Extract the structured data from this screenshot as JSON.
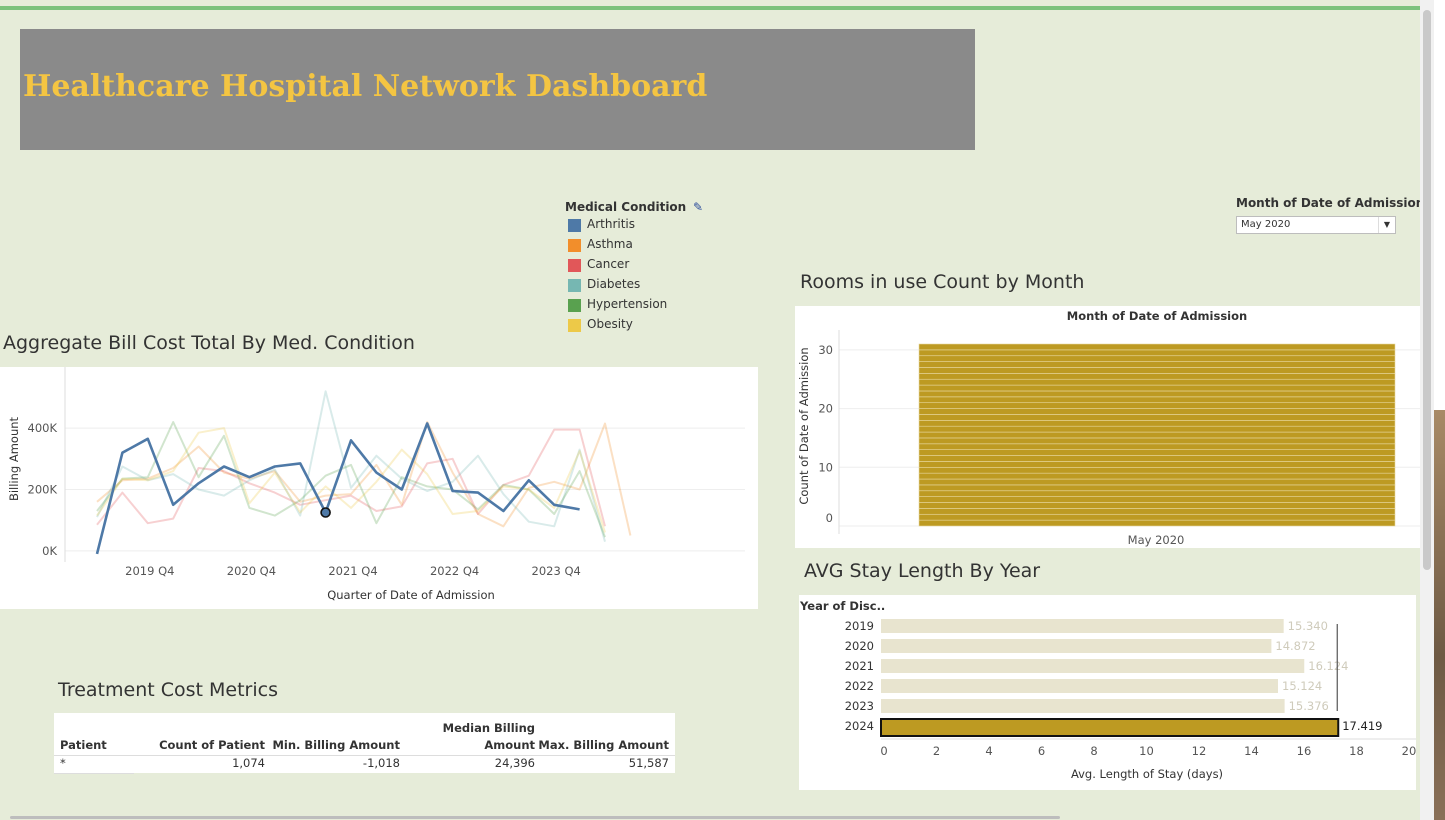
{
  "dashboard_title": "Healthcare Hospital Network Dashboard",
  "colors": {
    "accent_title": "#f4c542",
    "background": "#e6ecd9",
    "highlight_bar": "#bd9a22"
  },
  "sections": {
    "bill_cost": "Aggregate Bill Cost Total By Med. Condition",
    "rooms": "Rooms in use Count by Month",
    "stay": "AVG Stay Length By Year",
    "treatment": "Treatment Cost Metrics"
  },
  "legend": {
    "title": "Medical Condition",
    "edit_icon": "pencil-icon",
    "items": [
      {
        "label": "Arthritis",
        "color": "#4e79a7"
      },
      {
        "label": "Asthma",
        "color": "#f28e2b"
      },
      {
        "label": "Cancer",
        "color": "#e15759"
      },
      {
        "label": "Diabetes",
        "color": "#76b7b2"
      },
      {
        "label": "Hypertension",
        "color": "#59a14f"
      },
      {
        "label": "Obesity",
        "color": "#edc948"
      }
    ]
  },
  "filter": {
    "label": "Month of Date of Admission",
    "value": "May 2020"
  },
  "table": {
    "headers": [
      "Patient",
      "Count of Patient",
      "Min. Billing Amount",
      "Median Billing Amount",
      "Max. Billing Amount"
    ],
    "median_header_lines": [
      "Median Billing",
      "Amount"
    ],
    "row": [
      "*",
      "1,074",
      "-1,018",
      "24,396",
      "51,587"
    ]
  },
  "chart_data": [
    {
      "type": "line",
      "title": "Aggregate Bill Cost Total By Med. Condition",
      "xlabel": "Quarter of Date of Admission",
      "ylabel": "Billing Amount",
      "x_ticks": [
        "2019 Q4",
        "2020 Q4",
        "2021 Q4",
        "2022 Q4",
        "2023 Q4"
      ],
      "y_ticks": [
        "0K",
        "200K",
        "400K"
      ],
      "ylim": [
        -20000,
        560000
      ],
      "x": [
        "2019 Q2",
        "2019 Q3",
        "2019 Q4",
        "2020 Q1",
        "2020 Q2",
        "2020 Q3",
        "2020 Q4",
        "2021 Q1",
        "2021 Q2",
        "2021 Q3",
        "2021 Q4",
        "2022 Q1",
        "2022 Q2",
        "2022 Q3",
        "2022 Q4",
        "2023 Q1",
        "2023 Q2",
        "2023 Q3",
        "2023 Q4",
        "2024 Q1",
        "2024 Q2",
        "2024 Q3"
      ],
      "highlighted_series": "Arthritis",
      "series": [
        {
          "name": "Arthritis",
          "values": [
            -10000,
            320000,
            365000,
            150000,
            220000,
            275000,
            240000,
            275000,
            285000,
            125000,
            360000,
            255000,
            200000,
            415000,
            195000,
            190000,
            130000,
            230000,
            150000,
            135000,
            null,
            null
          ]
        },
        {
          "name": "Asthma",
          "values": [
            160000,
            230000,
            235000,
            270000,
            340000,
            255000,
            235000,
            260000,
            160000,
            180000,
            185000,
            280000,
            150000,
            420000,
            255000,
            120000,
            80000,
            205000,
            225000,
            200000,
            415000,
            50000
          ]
        },
        {
          "name": "Cancer",
          "values": [
            85000,
            190000,
            90000,
            105000,
            270000,
            260000,
            220000,
            190000,
            150000,
            165000,
            180000,
            130000,
            145000,
            285000,
            300000,
            120000,
            215000,
            245000,
            395000,
            395000,
            80000,
            null
          ]
        },
        {
          "name": "Diabetes",
          "values": [
            110000,
            275000,
            230000,
            250000,
            200000,
            180000,
            230000,
            265000,
            115000,
            520000,
            205000,
            310000,
            235000,
            195000,
            225000,
            310000,
            185000,
            95000,
            80000,
            330000,
            30000,
            null
          ]
        },
        {
          "name": "Hypertension",
          "values": [
            130000,
            235000,
            240000,
            420000,
            240000,
            375000,
            140000,
            115000,
            165000,
            245000,
            280000,
            90000,
            240000,
            210000,
            200000,
            135000,
            215000,
            200000,
            120000,
            260000,
            45000,
            null
          ]
        },
        {
          "name": "Obesity",
          "values": [
            115000,
            235000,
            230000,
            260000,
            385000,
            400000,
            155000,
            255000,
            125000,
            210000,
            140000,
            225000,
            330000,
            250000,
            120000,
            130000,
            210000,
            200000,
            140000,
            325000,
            60000,
            null
          ]
        }
      ],
      "marked_point": {
        "series": "Arthritis",
        "x": "2021 Q3"
      }
    },
    {
      "type": "bar",
      "title": "Month of Date of Admission",
      "categories": [
        "May 2020"
      ],
      "values": [
        31
      ],
      "stacked_unit_count": 31,
      "xlabel": "",
      "ylabel": "Count of Date of Admission",
      "y_ticks": [
        0,
        10,
        20,
        30
      ],
      "ylim": [
        0,
        31
      ]
    },
    {
      "type": "bar",
      "orientation": "horizontal",
      "row_header": "Year of Disc..",
      "categories": [
        "2019",
        "2020",
        "2021",
        "2022",
        "2023",
        "2024"
      ],
      "values": [
        15.34,
        14.872,
        16.124,
        15.124,
        15.376,
        17.419
      ],
      "value_labels": [
        "15.340",
        "14.872",
        "16.124",
        "15.124",
        "15.376",
        "17.419"
      ],
      "highlighted": "2024",
      "xlabel": "Avg. Length of Stay (days)",
      "x_ticks": [
        0,
        2,
        4,
        6,
        8,
        10,
        12,
        14,
        16,
        18,
        20
      ],
      "xlim": [
        0,
        20
      ]
    }
  ]
}
